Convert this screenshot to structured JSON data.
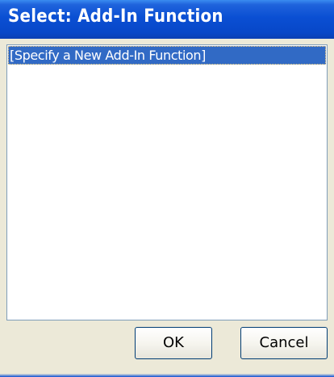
{
  "window": {
    "title": "Select: Add-In Function"
  },
  "list": {
    "items": [
      {
        "label": "[Specify a New Add-In Function]",
        "selected": true
      }
    ]
  },
  "buttons": {
    "ok_label": "OK",
    "cancel_label": "Cancel"
  },
  "colors": {
    "title_bar": "#0a4fd3",
    "selection": "#316ac5",
    "dialog_background": "#ece9d8"
  }
}
